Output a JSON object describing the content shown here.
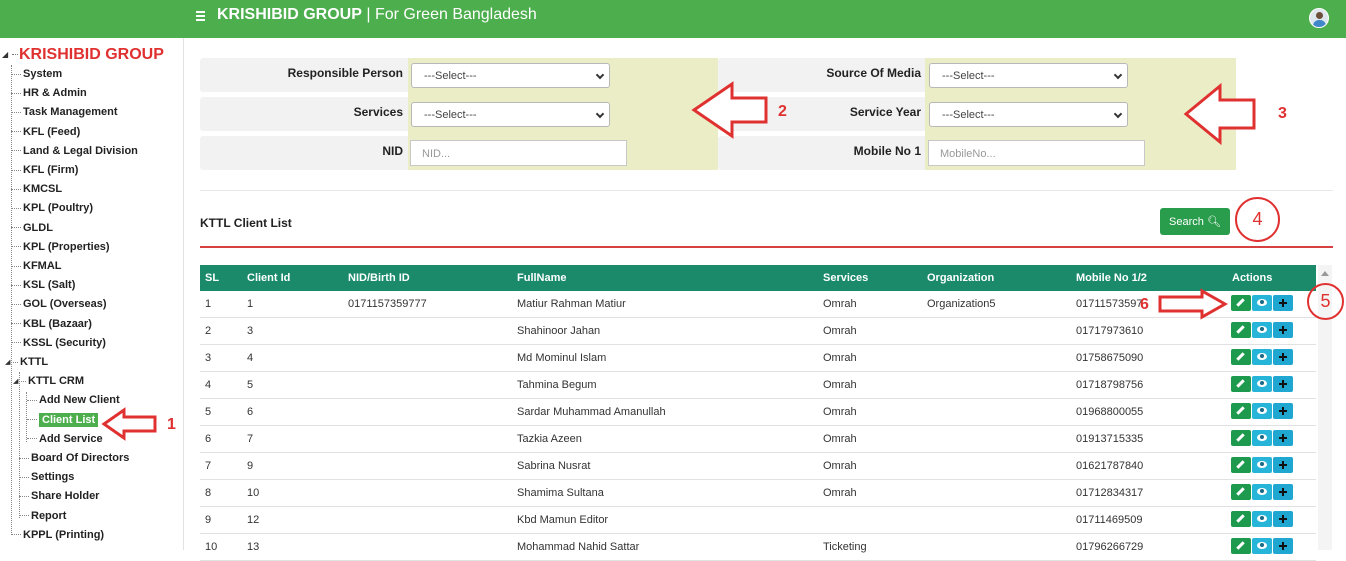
{
  "header": {
    "brand": "KRISHIBID GROUP",
    "tagline": " | For Green Bangladesh"
  },
  "sidebar": {
    "root": "KRISHIBID GROUP",
    "items": [
      {
        "label": "System"
      },
      {
        "label": "HR & Admin"
      },
      {
        "label": "Task Management"
      },
      {
        "label": "KFL (Feed)"
      },
      {
        "label": "Land & Legal Division"
      },
      {
        "label": "KFL (Firm)"
      },
      {
        "label": "KMCSL"
      },
      {
        "label": "KPL (Poultry)"
      },
      {
        "label": "GLDL"
      },
      {
        "label": "KPL (Properties)"
      },
      {
        "label": "KFMAL"
      },
      {
        "label": "KSL (Salt)"
      },
      {
        "label": "GOL (Overseas)"
      },
      {
        "label": "KBL (Bazaar)"
      },
      {
        "label": "KSSL (Security)"
      },
      {
        "label": "KTTL"
      },
      {
        "label": "KTTL CRM"
      },
      {
        "label": "Add New Client"
      },
      {
        "label": "Client List"
      },
      {
        "label": "Add Service"
      },
      {
        "label": "Board Of Directors"
      },
      {
        "label": "Settings"
      },
      {
        "label": "Share Holder"
      },
      {
        "label": "Report"
      },
      {
        "label": "KPPL (Printing)"
      }
    ]
  },
  "annotations": [
    "1",
    "2",
    "3",
    "4",
    "5",
    "6"
  ],
  "filters": {
    "responsible_person": {
      "label": "Responsible Person",
      "value": "---Select---"
    },
    "source_of_media": {
      "label": "Source Of Media",
      "value": "---Select---"
    },
    "services": {
      "label": "Services",
      "value": "---Select---"
    },
    "service_year": {
      "label": "Service Year",
      "value": "---Select---"
    },
    "nid": {
      "label": "NID",
      "placeholder": "NID..."
    },
    "mobile_no_1": {
      "label": "Mobile No 1",
      "placeholder": "MobileNo..."
    }
  },
  "list": {
    "title": "KTTL Client List",
    "search_label": "Search"
  },
  "table": {
    "headers": [
      "SL",
      "Client Id",
      "NID/Birth ID",
      "FullName",
      "Services",
      "Organization",
      "Mobile No 1/2",
      "Actions"
    ],
    "rows": [
      {
        "sl": "1",
        "client_id": "1",
        "nid": "0171157359777",
        "name": "Matiur Rahman Matiur",
        "service": "Omrah",
        "org": "Organization5",
        "mobile": "01711573597"
      },
      {
        "sl": "2",
        "client_id": "3",
        "nid": "",
        "name": "Shahinoor Jahan",
        "service": "Omrah",
        "org": "",
        "mobile": "01717973610"
      },
      {
        "sl": "3",
        "client_id": "4",
        "nid": "",
        "name": "Md Mominul Islam",
        "service": "Omrah",
        "org": "",
        "mobile": "01758675090"
      },
      {
        "sl": "4",
        "client_id": "5",
        "nid": "",
        "name": "Tahmina Begum",
        "service": "Omrah",
        "org": "",
        "mobile": "01718798756"
      },
      {
        "sl": "5",
        "client_id": "6",
        "nid": "",
        "name": "Sardar Muhammad Amanullah",
        "service": "Omrah",
        "org": "",
        "mobile": "01968800055"
      },
      {
        "sl": "6",
        "client_id": "7",
        "nid": "",
        "name": "Tazkia Azeen",
        "service": "Omrah",
        "org": "",
        "mobile": "01913715335"
      },
      {
        "sl": "7",
        "client_id": "9",
        "nid": "",
        "name": "Sabrina Nusrat",
        "service": "Omrah",
        "org": "",
        "mobile": "01621787840"
      },
      {
        "sl": "8",
        "client_id": "10",
        "nid": "",
        "name": "Shamima Sultana",
        "service": "Omrah",
        "org": "",
        "mobile": "01712834317"
      },
      {
        "sl": "9",
        "client_id": "12",
        "nid": "",
        "name": "Kbd Mamun Editor",
        "service": "",
        "org": "",
        "mobile": "01711469509"
      },
      {
        "sl": "10",
        "client_id": "13",
        "nid": "",
        "name": "Mohammad Nahid Sattar",
        "service": "Ticketing",
        "org": "",
        "mobile": "01796266729"
      }
    ]
  },
  "colors": {
    "primary": "#4cae4c",
    "table_header": "#1a8a6a",
    "annotation": "#e03131"
  }
}
